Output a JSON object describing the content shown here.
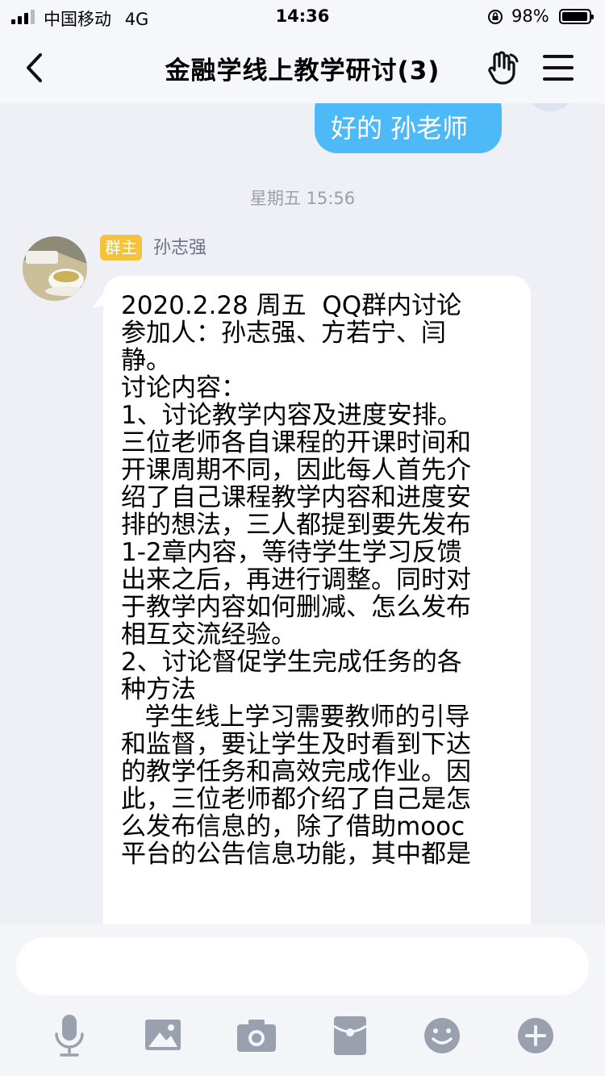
{
  "status_bar": {
    "carrier": "中国移动",
    "network": "4G",
    "time": "14:36",
    "battery_percent": "98%"
  },
  "nav": {
    "title": "金融学线上教学研讨(3)",
    "icons": [
      "back-icon",
      "hand-icon",
      "menu-icon"
    ]
  },
  "chat": {
    "my_message": "好的 孙老师",
    "timestamp": "星期五 15:56",
    "sender": {
      "badge": "群主",
      "name": "孙志强"
    },
    "message_lines": [
      "2020.2.28 周五  QQ群内讨论",
      "参加人：孙志强、方若宁、闫",
      "静。",
      "讨论内容：",
      "1、讨论教学内容及进度安排。",
      "三位老师各自课程的开课时间和",
      "开课周期不同，因此每人首先介",
      "绍了自己课程教学内容和进度安",
      "排的想法，三人都提到要先发布",
      "1-2章内容，等待学生学习反馈",
      "出来之后，再进行调整。同时对",
      "于教学内容如何删减、怎么发布",
      "相互交流经验。",
      "2、讨论督促学生完成任务的各",
      "种方法",
      "   学生线上学习需要教师的引导",
      "和监督，要让学生及时看到下达",
      "的教学任务和高效完成作业。因",
      "此，三位老师都介绍了自己是怎",
      "么发布信息的，除了借助mooc",
      "平台的公告信息功能，其中都是"
    ]
  },
  "input": {
    "value": "",
    "toolbar_icons": [
      "microphone-icon",
      "image-icon",
      "camera-icon",
      "red-packet-icon",
      "emoji-icon",
      "plus-icon"
    ]
  },
  "colors": {
    "my_bubble": "#4eb9f7",
    "owner_badge": "#f3c33d",
    "background": "#eef0f6",
    "icon_gray": "#9aa0ad"
  }
}
